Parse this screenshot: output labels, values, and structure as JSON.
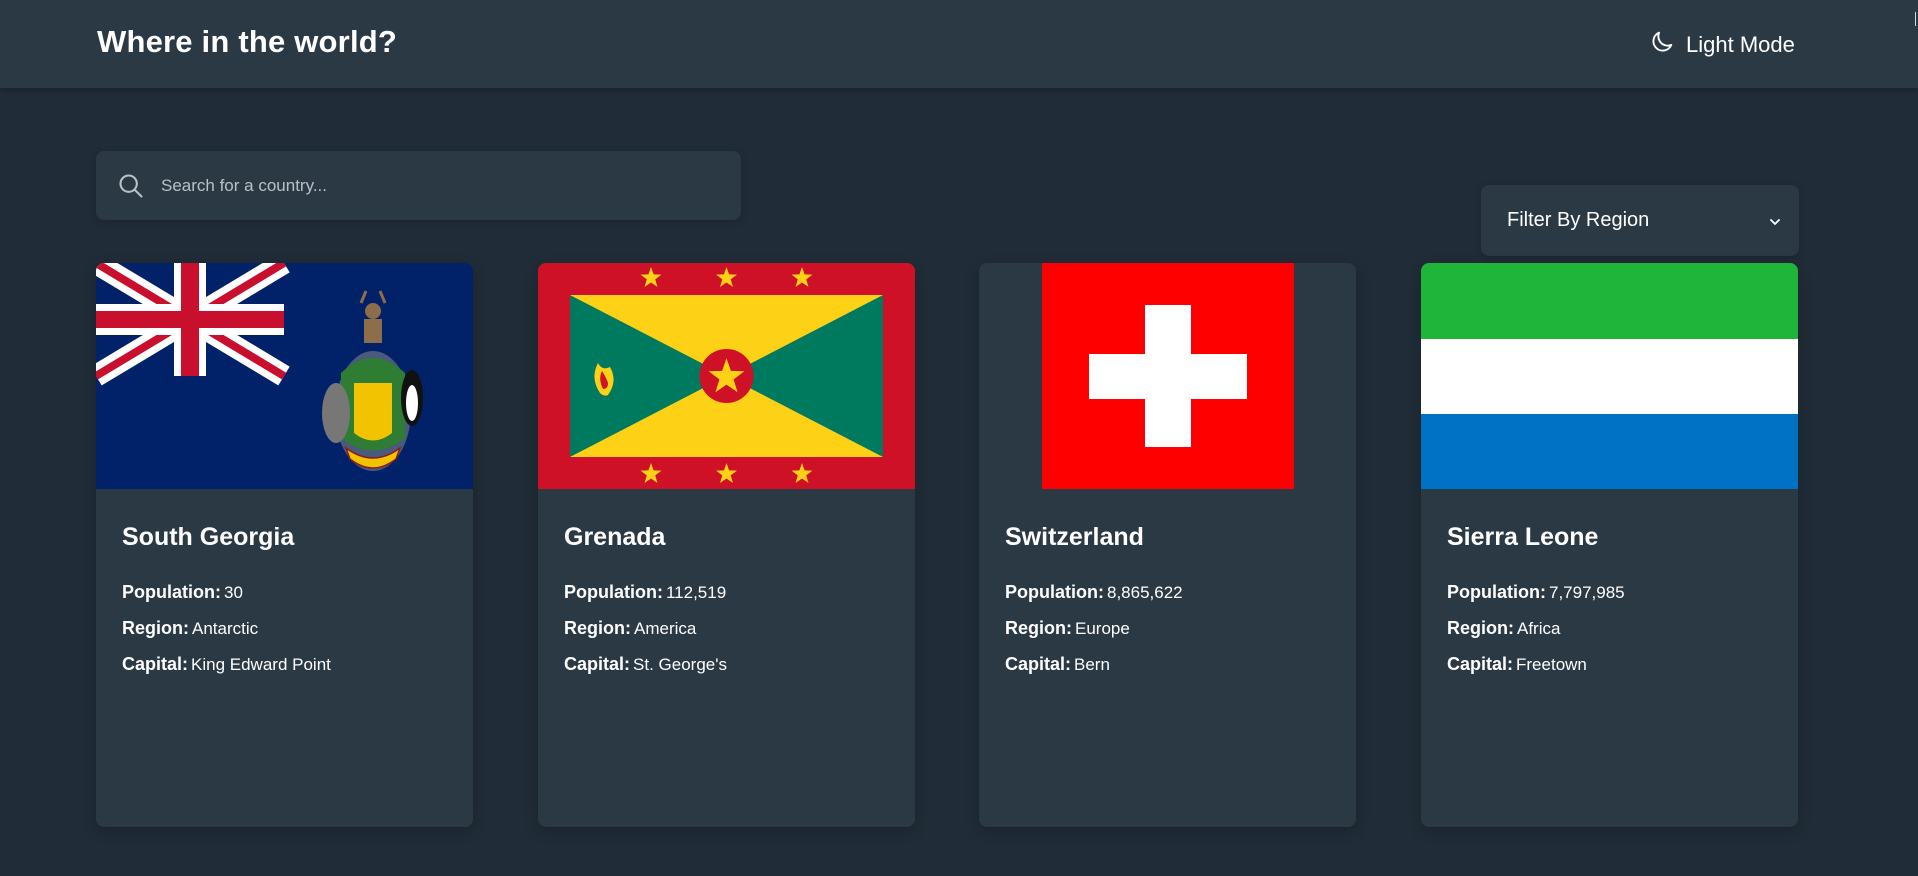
{
  "header": {
    "title": "Where in the world?",
    "theme_toggle_label": "Light Mode",
    "theme_icon": "moon-icon"
  },
  "search": {
    "placeholder": "Search for a country...",
    "value": "",
    "icon": "search-icon"
  },
  "filter": {
    "label": "Filter By Region",
    "icon": "chevron-down-icon"
  },
  "labels": {
    "population": "Population:",
    "region": "Region:",
    "capital": "Capital:"
  },
  "countries": [
    {
      "name": "South Georgia",
      "population": "30",
      "region": "Antarctic",
      "capital": "King Edward Point",
      "flag": "south-georgia-flag"
    },
    {
      "name": "Grenada",
      "population": "112,519",
      "region": "America",
      "capital": "St. George's",
      "flag": "grenada-flag"
    },
    {
      "name": "Switzerland",
      "population": "8,865,622",
      "region": "Europe",
      "capital": "Bern",
      "flag": "switzerland-flag"
    },
    {
      "name": "Sierra Leone",
      "population": "7,797,985",
      "region": "Africa",
      "capital": "Freetown",
      "flag": "sierra-leone-flag"
    }
  ],
  "colors": {
    "background": "#202c37",
    "element": "#2b3945",
    "text": "#ffffff"
  }
}
